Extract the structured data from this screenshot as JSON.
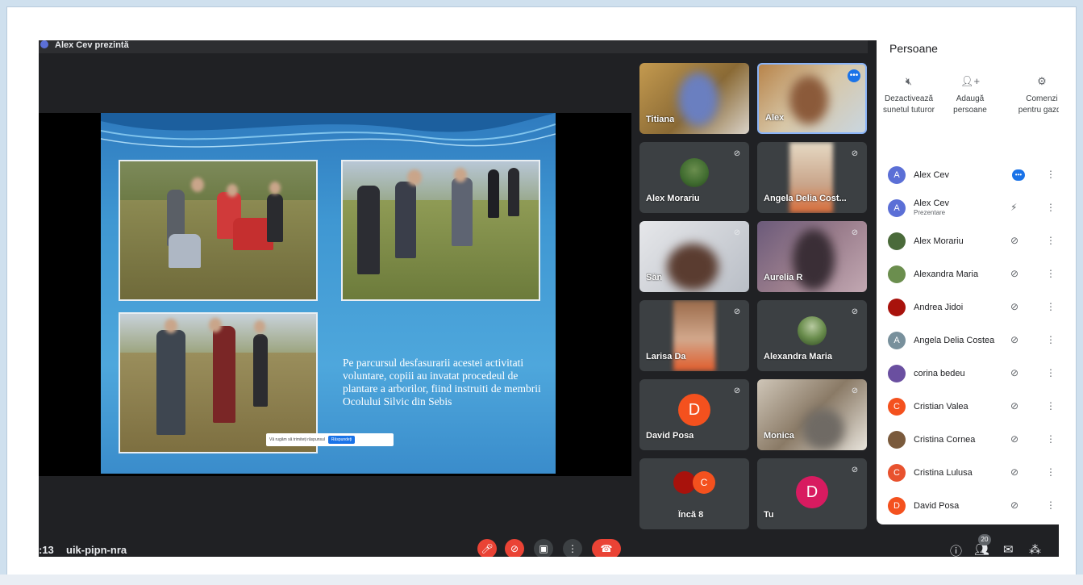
{
  "presenting_banner": "Alex Cev prezintă",
  "slide": {
    "text": "Pe parcursul desfasurarii acestei activitati voluntare, copiii au invatat procedeul de plantare a arborilor, fiind instruiti de membrii Ocolului Silvic din Sebis",
    "translate_prompt": "Vă rugăm să trimiteți răspunsul",
    "translate_button": "Răspundeți"
  },
  "tiles": [
    {
      "name": "Titiana",
      "type": "video"
    },
    {
      "name": "Alex",
      "type": "video"
    },
    {
      "name": "Alex Morariu",
      "type": "avatar"
    },
    {
      "name": "Angela Delia Cost...",
      "type": "video"
    },
    {
      "name": "Săn",
      "type": "video"
    },
    {
      "name": "Aurelia R",
      "type": "video"
    },
    {
      "name": "Larisa Da",
      "type": "video"
    },
    {
      "name": "Alexandra Maria",
      "type": "avatar"
    },
    {
      "name": "David Posa",
      "type": "letter",
      "letter": "D",
      "color": "#f4511e"
    },
    {
      "name": "Monica",
      "type": "video"
    },
    {
      "name": "Încă 8",
      "type": "more",
      "letter": "C"
    },
    {
      "name": "Tu",
      "type": "letter",
      "letter": "D",
      "color": "#d81b60"
    }
  ],
  "panel": {
    "title": "Persoane",
    "actions": [
      {
        "icon": "mute-all-icon",
        "label": "Dezactivează sunetul tuturor"
      },
      {
        "icon": "add-person-icon",
        "label": "Adaugă persoane"
      },
      {
        "icon": "host-controls-icon",
        "label": "Comenzi pentru gazdă"
      }
    ],
    "participants": [
      {
        "name": "Alex Cev",
        "sub": "",
        "letter": "A",
        "color": "#5b6fd6",
        "state": "speaking"
      },
      {
        "name": "Alex Cev",
        "sub": "Prezentare",
        "letter": "A",
        "color": "#5b6fd6",
        "state": "presenting"
      },
      {
        "name": "Alex Morariu",
        "sub": "",
        "letter": "",
        "color": "#4a6a3a",
        "state": "muted"
      },
      {
        "name": "Alexandra Maria",
        "sub": "",
        "letter": "",
        "color": "#6b8e4e",
        "state": "muted"
      },
      {
        "name": "Andrea Jidoi",
        "sub": "",
        "letter": "",
        "color": "#a8120c",
        "state": "muted"
      },
      {
        "name": "Angela Delia Costea",
        "sub": "",
        "letter": "A",
        "color": "#78909c",
        "state": "muted"
      },
      {
        "name": "corina bedeu",
        "sub": "",
        "letter": "",
        "color": "#6a4fa0",
        "state": "muted"
      },
      {
        "name": "Cristian Valea",
        "sub": "",
        "letter": "C",
        "color": "#f4511e",
        "state": "muted"
      },
      {
        "name": "Cristina Cornea",
        "sub": "",
        "letter": "",
        "color": "#7a5a3c",
        "state": "muted"
      },
      {
        "name": "Cristina Lulusa",
        "sub": "",
        "letter": "C",
        "color": "#e8522e",
        "state": "muted"
      },
      {
        "name": "David Posa",
        "sub": "",
        "letter": "D",
        "color": "#f4511e",
        "state": "muted"
      }
    ]
  },
  "bottombar": {
    "time": ":13",
    "meeting_code": "uik-pipn-nra",
    "participants_count": "20"
  },
  "colors": {
    "meet_bg": "#202124",
    "tile_bg": "#3c4043",
    "danger": "#ea4335",
    "accent": "#1a73e8"
  }
}
